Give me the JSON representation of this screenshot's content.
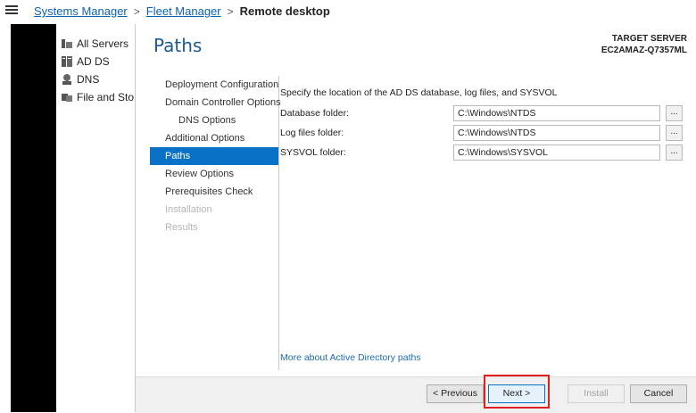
{
  "breadcrumb": {
    "items": [
      "Systems Manager",
      "Fleet Manager",
      "Remote desktop"
    ]
  },
  "server_manager_nav": {
    "items": [
      {
        "label": "All Servers",
        "icon": "servers-icon"
      },
      {
        "label": "AD DS",
        "icon": "adds-icon"
      },
      {
        "label": "DNS",
        "icon": "dns-icon"
      },
      {
        "label": "File and Sto",
        "icon": "file-storage-icon"
      }
    ]
  },
  "wizard": {
    "title": "Paths",
    "target_label": "TARGET SERVER",
    "target_value": "EC2AMAZ-Q7357ML",
    "steps": [
      {
        "label": "Deployment Configuration",
        "state": "normal"
      },
      {
        "label": "Domain Controller Options",
        "state": "normal"
      },
      {
        "label": "DNS Options",
        "state": "sub"
      },
      {
        "label": "Additional Options",
        "state": "normal"
      },
      {
        "label": "Paths",
        "state": "active"
      },
      {
        "label": "Review Options",
        "state": "normal"
      },
      {
        "label": "Prerequisites Check",
        "state": "normal"
      },
      {
        "label": "Installation",
        "state": "disabled"
      },
      {
        "label": "Results",
        "state": "disabled"
      }
    ],
    "intro": "Specify the location of the AD DS database, log files, and SYSVOL",
    "fields": [
      {
        "label": "Database folder:",
        "value": "C:\\Windows\\NTDS",
        "browse": "..."
      },
      {
        "label": "Log files folder:",
        "value": "C:\\Windows\\NTDS",
        "browse": "..."
      },
      {
        "label": "SYSVOL folder:",
        "value": "C:\\Windows\\SYSVOL",
        "browse": "..."
      }
    ],
    "more_link": "More about Active Directory paths",
    "buttons": {
      "previous": "< Previous",
      "next": "Next >",
      "install": "Install",
      "cancel": "Cancel"
    }
  },
  "colors": {
    "accent": "#0a72c6",
    "title": "#1c5a8f",
    "link": "#0b63b3",
    "highlight": "#e02020"
  }
}
